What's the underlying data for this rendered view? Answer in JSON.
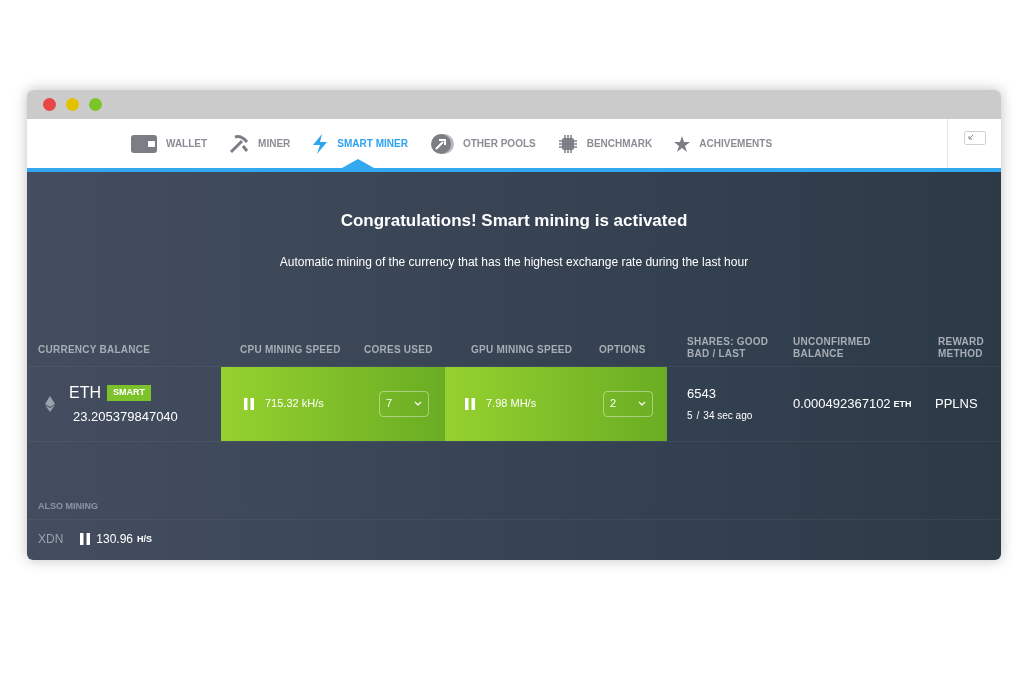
{
  "tabs": [
    {
      "label": "WALLET",
      "kind": "wallet",
      "selected": false
    },
    {
      "label": "MINER",
      "kind": "pick",
      "selected": false
    },
    {
      "label": "SMART MINER",
      "kind": "bolt",
      "selected": true
    },
    {
      "label": "OTHER POOLS",
      "kind": "pool",
      "selected": false
    },
    {
      "label": "BENCHMARK",
      "kind": "chip",
      "selected": false
    },
    {
      "label": "ACHIVEMENTS",
      "kind": "star",
      "selected": false
    }
  ],
  "headline": "Congratulations! Smart mining is activated",
  "subline": "Automatic mining of the currency that has the highest exchange rate during the last hour",
  "columns": {
    "currency": "CURRENCY BALANCE",
    "cpu_speed": "CPU MINING SPEED",
    "cores": "CORES USED",
    "gpu_speed": "GPU MINING SPEED",
    "options": "OPTIONS",
    "shares": [
      "SHARES: GOOD",
      "BAD / LAST"
    ],
    "unconfirmed": [
      "UNCONFIRMED",
      "BALANCE"
    ],
    "reward": [
      "REWARD",
      "METHOD"
    ]
  },
  "row": {
    "currency": "ETH",
    "badge": "SMART",
    "balance": "23.205379847040",
    "cpu_speed": "715.32 kH/s",
    "cores": "7",
    "gpu_speed": "7.98 MH/s",
    "options": "2",
    "shares_good": "6543",
    "shares_bad": "5",
    "shares_sep": "/",
    "shares_last": "34 sec ago",
    "unconfirmed": "0.000492367102",
    "unconfirmed_unit": "ETH",
    "reward": "PPLNS"
  },
  "also_mining": {
    "label": "ALSO MINING",
    "currency": "XDN",
    "speed": "130.96",
    "unit": "H/S"
  }
}
